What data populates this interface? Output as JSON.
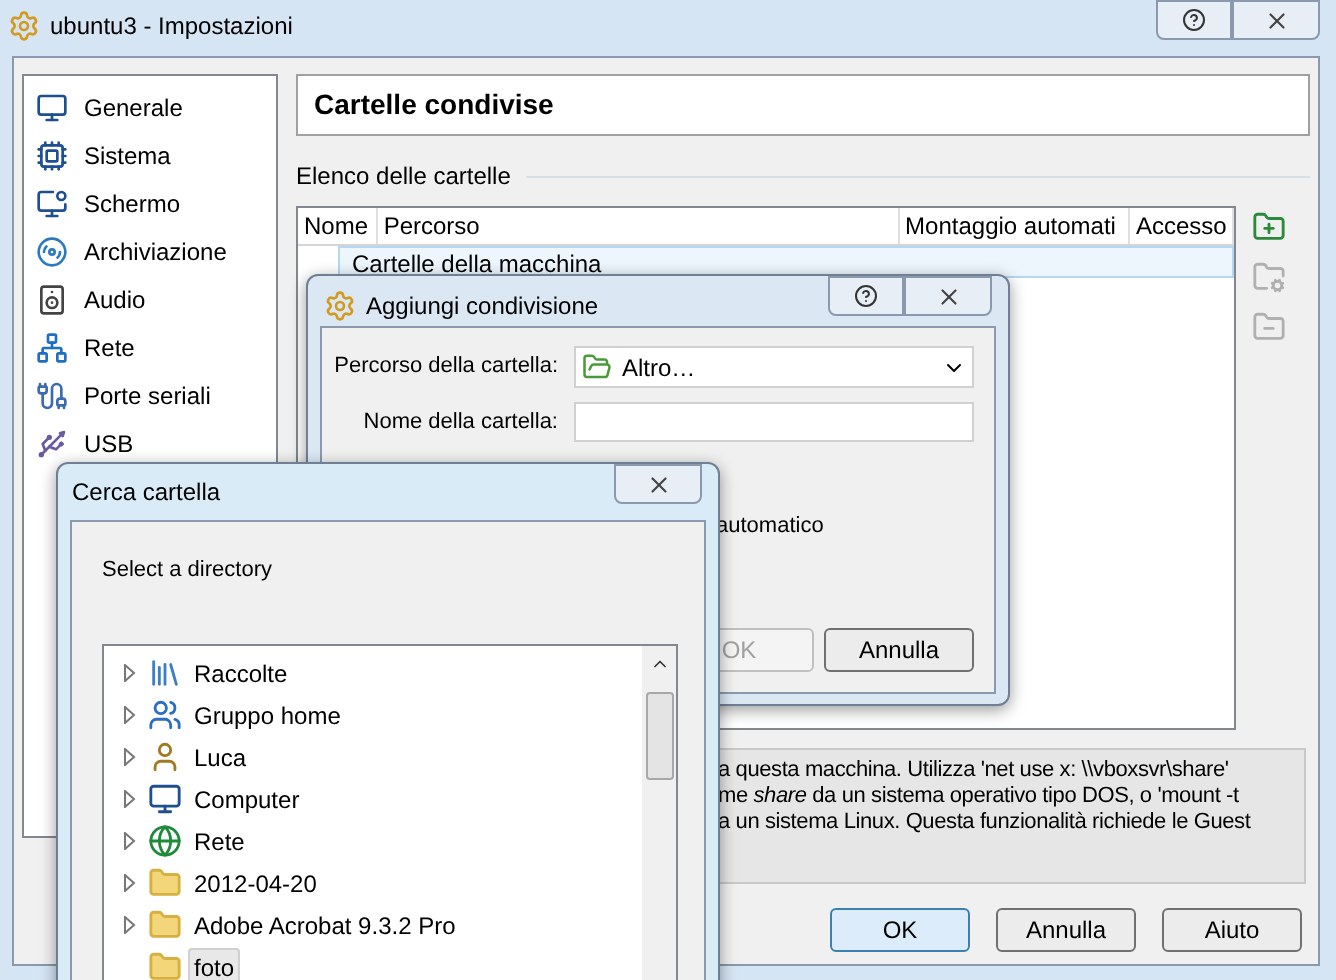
{
  "window": {
    "title": "ubuntu3 - Impostazioni"
  },
  "sidebar": {
    "items": [
      {
        "label": "Generale",
        "selected": false
      },
      {
        "label": "Sistema",
        "selected": false
      },
      {
        "label": "Schermo",
        "selected": false
      },
      {
        "label": "Archiviazione",
        "selected": false
      },
      {
        "label": "Audio",
        "selected": false
      },
      {
        "label": "Rete",
        "selected": false
      },
      {
        "label": "Porte seriali",
        "selected": false
      },
      {
        "label": "USB",
        "selected": false
      }
    ]
  },
  "page": {
    "title": "Cartelle condivise",
    "section": "Elenco delle cartelle",
    "table": {
      "columns": [
        "Nome",
        "Percorso",
        "Montaggio automati",
        "Accesso"
      ],
      "rows": [
        {
          "label": "Cartelle della macchina",
          "selected": true
        }
      ]
    },
    "info_lines": [
      "a questa macchina. Utilizza 'net use x: \\\\vboxsvr\\share'",
      "me *share* da un sistema operativo tipo DOS, o 'mount -t",
      "a un sistema Linux. Questa funzionalità richiede le Guest"
    ]
  },
  "buttons": [
    {
      "label": "OK",
      "default": true
    },
    {
      "label": "Annulla",
      "default": false
    },
    {
      "label": "Aiuto",
      "default": false
    }
  ],
  "add_share_dialog": {
    "title": "Aggiungi condivisione",
    "fields": [
      {
        "kind": "combo",
        "label": "Percorso della cartella:",
        "value": "Altro…"
      },
      {
        "kind": "text",
        "label": "Nome della cartella:"
      }
    ],
    "checkbox_label": "automatico",
    "buttons": [
      {
        "label": "OK",
        "disabled": true
      },
      {
        "label": "Annulla",
        "disabled": false
      }
    ]
  },
  "folder_dialog": {
    "title": "Cerca cartella",
    "prompt": "Select a directory",
    "items": [
      {
        "label": "Raccolte",
        "expandable": true,
        "selected": false
      },
      {
        "label": "Gruppo home",
        "expandable": true,
        "selected": false
      },
      {
        "label": "Luca",
        "expandable": true,
        "selected": false
      },
      {
        "label": "Computer",
        "expandable": true,
        "selected": false
      },
      {
        "label": "Rete",
        "expandable": true,
        "selected": false
      },
      {
        "label": "2012-04-20",
        "expandable": true,
        "selected": false
      },
      {
        "label": "Adobe Acrobat 9.3.2 Pro",
        "expandable": true,
        "selected": false
      },
      {
        "label": "foto",
        "expandable": false,
        "selected": true
      }
    ]
  }
}
